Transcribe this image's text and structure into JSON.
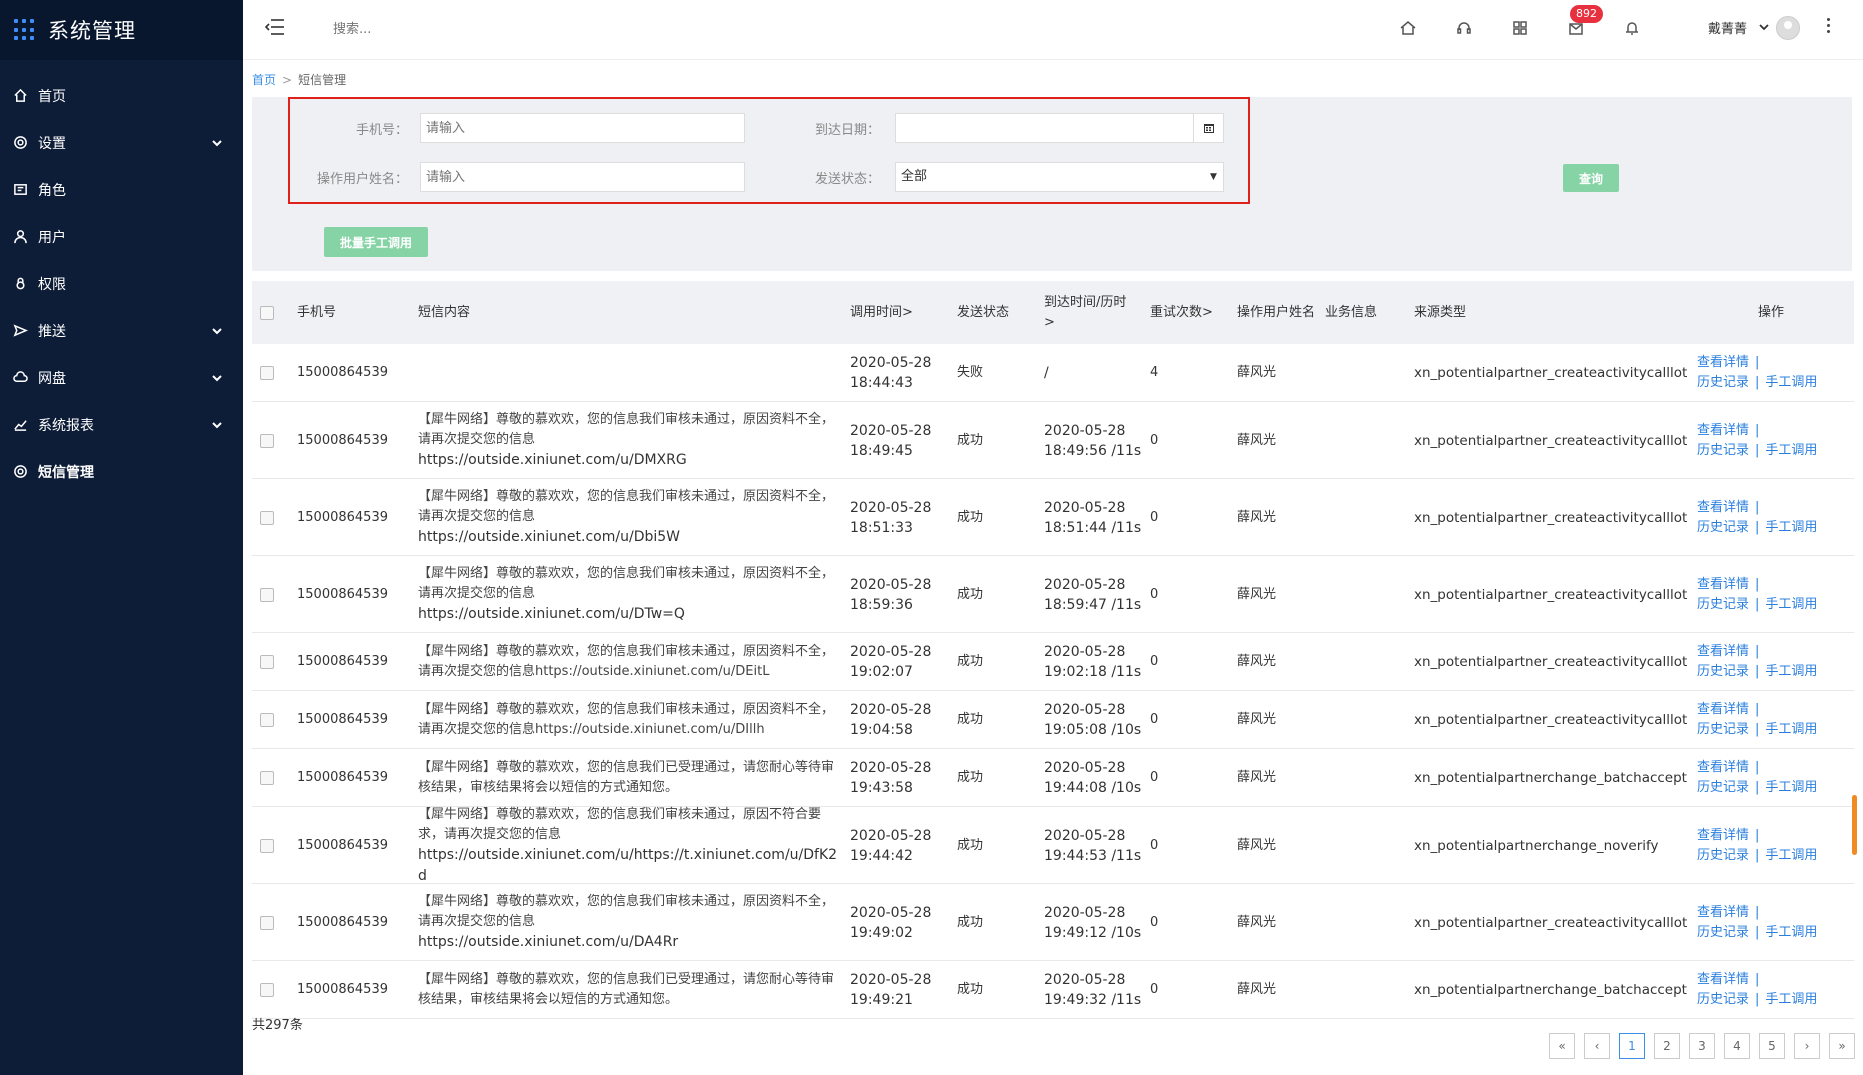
{
  "brand": {
    "title": "系统管理"
  },
  "menu": [
    {
      "label": "首页",
      "icon": "home-icon",
      "chevron": false
    },
    {
      "label": "设置",
      "icon": "gear-icon",
      "chevron": true
    },
    {
      "label": "角色",
      "icon": "id-card-icon",
      "chevron": false
    },
    {
      "label": "用户",
      "icon": "user-icon",
      "chevron": false
    },
    {
      "label": "权限",
      "icon": "lock-icon",
      "chevron": false
    },
    {
      "label": "推送",
      "icon": "send-icon",
      "chevron": true
    },
    {
      "label": "网盘",
      "icon": "cloud-icon",
      "chevron": true
    },
    {
      "label": "系统报表",
      "icon": "chart-icon",
      "chevron": true
    },
    {
      "label": "短信管理",
      "icon": "gear-icon",
      "chevron": false,
      "active": true
    }
  ],
  "header": {
    "search_placeholder": "搜索...",
    "badge": "892",
    "user_name": "戴菁菁"
  },
  "breadcrumb": {
    "home": "首页",
    "sep": ">",
    "current": "短信管理"
  },
  "filters": {
    "phone_label": "手机号：",
    "phone_placeholder": "请输入",
    "date_label": "到达日期：",
    "operator_label": "操作用户姓名：",
    "operator_placeholder": "请输入",
    "status_label": "发送状态：",
    "status_value": "全部",
    "query_btn": "查询",
    "batch_btn": "批量手工调用"
  },
  "table": {
    "headers": {
      "phone": "手机号",
      "content": "短信内容",
      "call_time": "调用时间>",
      "status": "发送状态",
      "arrive": "到达时间/历时 >",
      "retry": "重试次数>",
      "operator": "操作用户姓名",
      "biz": "业务信息",
      "source": "来源类型",
      "action": "操作"
    },
    "link_detail": "查看详情",
    "link_history": "历史记录",
    "link_manual": "手工调用",
    "rows": [
      {
        "phone": "15000864539",
        "content": "",
        "url": "",
        "date": "2020-05-28",
        "time": "18:44:43",
        "status": "失败",
        "arrive_date": "/",
        "arrive_time": "",
        "retry": "4",
        "operator": "薛风光",
        "source": "xn_potentialpartner_createactivitycalllot"
      },
      {
        "phone": "15000864539",
        "content": "【犀牛网络】尊敬的慕欢欢，您的信息我们审核未通过，原因资料不全，请再次提交您的信息",
        "url": "https://outside.xiniunet.com/u/DMXRG",
        "date": "2020-05-28",
        "time": "18:49:45",
        "status": "成功",
        "arrive_date": "2020-05-28",
        "arrive_time": "18:49:56 /11s",
        "retry": "0",
        "operator": "薛风光",
        "source": "xn_potentialpartner_createactivitycalllot"
      },
      {
        "phone": "15000864539",
        "content": "【犀牛网络】尊敬的慕欢欢，您的信息我们审核未通过，原因资料不全，请再次提交您的信息",
        "url": "https://outside.xiniunet.com/u/Dbi5W",
        "date": "2020-05-28",
        "time": "18:51:33",
        "status": "成功",
        "arrive_date": "2020-05-28",
        "arrive_time": "18:51:44 /11s",
        "retry": "0",
        "operator": "薛风光",
        "source": "xn_potentialpartner_createactivitycalllot"
      },
      {
        "phone": "15000864539",
        "content": "【犀牛网络】尊敬的慕欢欢，您的信息我们审核未通过，原因资料不全，请再次提交您的信息",
        "url": "https://outside.xiniunet.com/u/DTw=Q",
        "date": "2020-05-28",
        "time": "18:59:36",
        "status": "成功",
        "arrive_date": "2020-05-28",
        "arrive_time": "18:59:47 /11s",
        "retry": "0",
        "operator": "薛风光",
        "source": "xn_potentialpartner_createactivitycalllot"
      },
      {
        "phone": "15000864539",
        "content": "【犀牛网络】尊敬的慕欢欢，您的信息我们审核未通过，原因资料不全，请再次提交您的信息https://outside.xiniunet.com/u/DEitL",
        "url": "",
        "date": "2020-05-28",
        "time": "19:02:07",
        "status": "成功",
        "arrive_date": "2020-05-28",
        "arrive_time": "19:02:18 /11s",
        "retry": "0",
        "operator": "薛风光",
        "source": "xn_potentialpartner_createactivitycalllot"
      },
      {
        "phone": "15000864539",
        "content": "【犀牛网络】尊敬的慕欢欢，您的信息我们审核未通过，原因资料不全，请再次提交您的信息https://outside.xiniunet.com/u/DIllh",
        "url": "",
        "date": "2020-05-28",
        "time": "19:04:58",
        "status": "成功",
        "arrive_date": "2020-05-28",
        "arrive_time": "19:05:08 /10s",
        "retry": "0",
        "operator": "薛风光",
        "source": "xn_potentialpartner_createactivitycalllot"
      },
      {
        "phone": "15000864539",
        "content": "【犀牛网络】尊敬的慕欢欢，您的信息我们已受理通过，请您耐心等待审核结果，审核结果将会以短信的方式通知您。",
        "url": "",
        "date": "2020-05-28",
        "time": "19:43:58",
        "status": "成功",
        "arrive_date": "2020-05-28",
        "arrive_time": "19:44:08 /10s",
        "retry": "0",
        "operator": "薛风光",
        "source": "xn_potentialpartnerchange_batchaccept"
      },
      {
        "phone": "15000864539",
        "content": "【犀牛网络】尊敬的慕欢欢，您的信息我们审核未通过，原因不符合要求，请再次提交您的信息",
        "url": "https://outside.xiniunet.com/u/https://t.xiniunet.com/u/DfK2d",
        "date": "2020-05-28",
        "time": "19:44:42",
        "status": "成功",
        "arrive_date": "2020-05-28",
        "arrive_time": "19:44:53 /11s",
        "retry": "0",
        "operator": "薛风光",
        "source": "xn_potentialpartnerchange_noverify"
      },
      {
        "phone": "15000864539",
        "content": "【犀牛网络】尊敬的慕欢欢，您的信息我们审核未通过，原因资料不全，请再次提交您的信息",
        "url": "https://outside.xiniunet.com/u/DA4Rr",
        "date": "2020-05-28",
        "time": "19:49:02",
        "status": "成功",
        "arrive_date": "2020-05-28",
        "arrive_time": "19:49:12 /10s",
        "retry": "0",
        "operator": "薛风光",
        "source": "xn_potentialpartner_createactivitycalllot"
      },
      {
        "phone": "15000864539",
        "content": "【犀牛网络】尊敬的慕欢欢，您的信息我们已受理通过，请您耐心等待审核结果，审核结果将会以短信的方式通知您。",
        "url": "",
        "date": "2020-05-28",
        "time": "19:49:21",
        "status": "成功",
        "arrive_date": "2020-05-28",
        "arrive_time": "19:49:32 /11s",
        "retry": "0",
        "operator": "薛风光",
        "source": "xn_potentialpartnerchange_batchaccept"
      }
    ]
  },
  "footer": {
    "total": "共297条",
    "pages": [
      "«",
      "‹",
      "1",
      "2",
      "3",
      "4",
      "5",
      "›",
      "»"
    ],
    "current_page": "1"
  }
}
